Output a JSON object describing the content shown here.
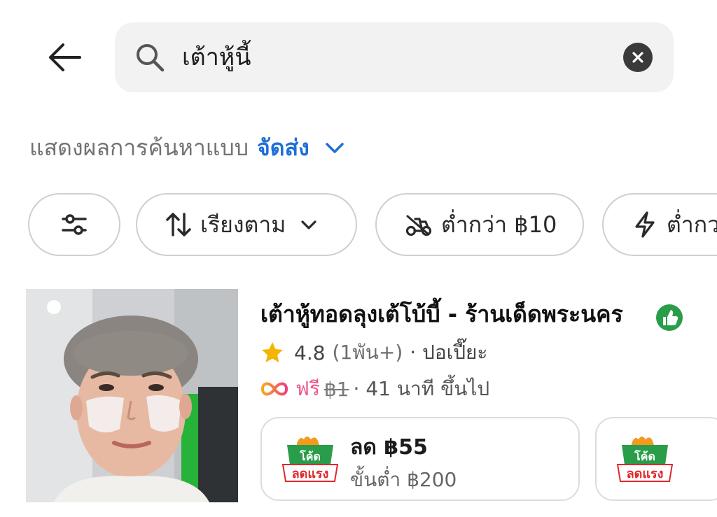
{
  "search": {
    "query": "เต้าหู้นี้"
  },
  "results_mode": {
    "prefix": "แสดงผลการค้นหาแบบ",
    "value": "จัดส่ง"
  },
  "filters": [
    {
      "label": "",
      "icon": "sliders-icon"
    },
    {
      "label": "เรียงตาม",
      "icon": "sort-arrows-icon"
    },
    {
      "label": "ต่ำกว่า ฿10",
      "icon": "delivery-scooter-icon"
    },
    {
      "label": "ต่ำกว",
      "icon": "lightning-icon"
    }
  ],
  "restaurant": {
    "name": "เต้าหู้ทอดลุงเต้โบ้บี้ - ร้านเด็ดพระนคร",
    "rating": "4.8",
    "review_count": "(1พัน+)",
    "cuisine": "· ปอเปี๊ยะ",
    "free_label": "ฟรี",
    "old_fee": "฿1",
    "time": "· 41 นาที ขึ้นไป"
  },
  "promos": [
    {
      "badge_top": "โค้ด",
      "badge_bottom": "ลดแรง",
      "title": "ลด ฿55",
      "subtitle": "ขั้นต่ำ ฿200"
    },
    {
      "badge_top": "โค้ด",
      "badge_bottom": "ลดแรง",
      "title": "",
      "subtitle": ""
    }
  ],
  "colors": {
    "accent_blue": "#1e6fd8",
    "free_pink": "#f0508a",
    "badge_green": "#2a9d4a",
    "badge_red": "#e2262a",
    "star": "#f5b400"
  }
}
